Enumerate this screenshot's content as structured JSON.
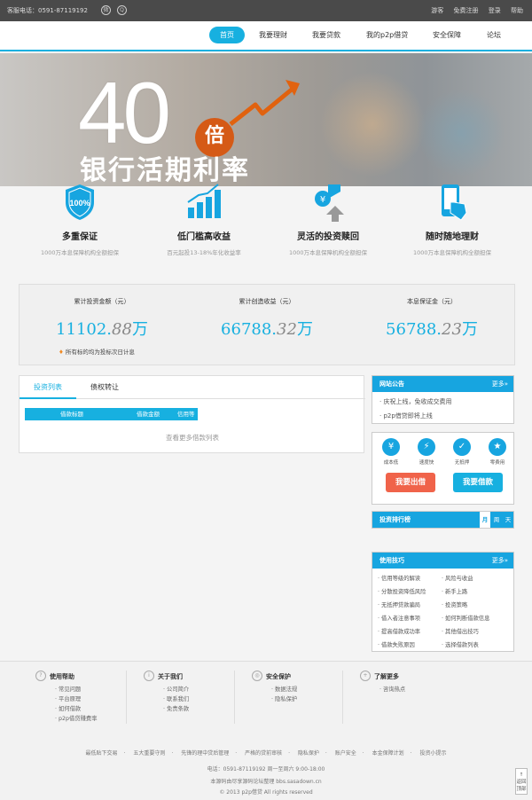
{
  "topbar": {
    "hotline": "客服电话：0591-87119192",
    "icon1": "weibo-icon",
    "icon2": "qq-icon",
    "links": [
      "游客",
      "免费注册",
      "登录",
      "帮助"
    ]
  },
  "nav": {
    "items": [
      "首页",
      "我要理财",
      "我要贷款",
      "我的p2p借贷",
      "安全保障",
      "论坛"
    ],
    "active": 0
  },
  "banner": {
    "number": "40",
    "badge": "倍",
    "headline": "银行活期利率"
  },
  "features": [
    {
      "title": "多重保证",
      "desc": "1000万本息保障机构全额担保",
      "icon": "shield-icon"
    },
    {
      "title": "低门槛高收益",
      "desc": "百元起投13-18%年化收益率",
      "icon": "bar-chart-icon"
    },
    {
      "title": "灵活的投资赎回",
      "desc": "1000万本息保障机构全额担保",
      "icon": "yen-exchange-icon"
    },
    {
      "title": "随时随地理财",
      "desc": "1000万本息保障机构全额担保",
      "icon": "mobile-touch-icon"
    }
  ],
  "stats": [
    {
      "label": "累计投资金额（元）",
      "int": "11102.",
      "dec": "88",
      "unit": "万"
    },
    {
      "label": "累计创造收益（元）",
      "int": "66788.",
      "dec": "32",
      "unit": "万"
    },
    {
      "label": "本息保证金（元）",
      "int": "56788.",
      "dec": "23",
      "unit": "万"
    }
  ],
  "stats_note": "所有标的均为投标次日计息",
  "invest": {
    "tabs": [
      "投资列表",
      "债权转让"
    ],
    "columns": [
      "借款标题",
      "借款金额",
      "信用等"
    ],
    "more": "查看更多借款列表"
  },
  "notice": {
    "title": "网站公告",
    "more": "更多»",
    "items": [
      "庆祝上线，免收成交费用",
      "p2p借贷即将上线"
    ]
  },
  "quick": {
    "items": [
      {
        "label": "成本低",
        "glyph": "¥"
      },
      {
        "label": "速度快",
        "glyph": "⚡"
      },
      {
        "label": "无抵押",
        "glyph": "✓"
      },
      {
        "label": "零费用",
        "glyph": "★"
      }
    ],
    "lend": "我要出借",
    "borrow": "我要借款",
    "lend_color": "#f0634a",
    "borrow_color": "#17b0e0"
  },
  "rank": {
    "title": "投资排行榜",
    "periods": [
      "月",
      "周",
      "天"
    ]
  },
  "tips": {
    "title": "使用技巧",
    "more": "更多»",
    "left": [
      "信用等级的解读",
      "分散投资降低风险",
      "无抵押贷款骗局",
      "借入者注意事项",
      "提高借款成功率",
      "借款失败原因"
    ],
    "right": [
      "风险与收益",
      "新手上路",
      "投资策略",
      "如何判断借款信息",
      "其他借出技巧",
      "选择借款列表"
    ]
  },
  "footer": {
    "cols": [
      {
        "title": "使用帮助",
        "icon": "?",
        "items": [
          "常见问题",
          "平台原理",
          "如何借款",
          "p2p借贷赚费率"
        ]
      },
      {
        "title": "关于我们",
        "icon": "i",
        "items": [
          "公司简介",
          "联系我们",
          "免责条款"
        ]
      },
      {
        "title": "安全保护",
        "icon": "◎",
        "items": [
          "数据法规",
          "隐私保护"
        ]
      },
      {
        "title": "了解更多",
        "icon": "+",
        "items": [
          "咨询热点"
        ]
      }
    ],
    "links": [
      "最低贴下交易",
      "五大重要守则",
      "先锋的理中贷后管理",
      "严格的贷前审核",
      "隐私保护",
      "账户安全",
      "本金保障计划",
      "投资小提示"
    ],
    "phone": "电话：0591-87119192 周一至周六 9:00-18:00",
    "source": "本源码由尽享源码论坛整理 bbs.sasadown.cn",
    "copyright": "© 2013 p2p借贷 All rights reserved",
    "totop": "返回顶部"
  },
  "colors": {
    "accent": "#17b0e0",
    "orange": "#d55a16",
    "topbar": "#4a4a4a"
  }
}
